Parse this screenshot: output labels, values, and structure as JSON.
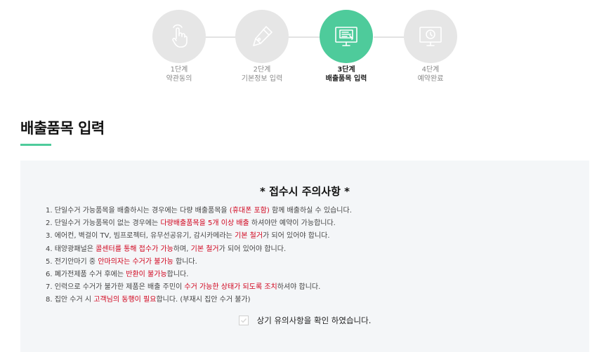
{
  "steps": [
    {
      "num": "1단계",
      "name": "약관동의",
      "icon": "hand-pointer-icon",
      "active": false
    },
    {
      "num": "2단계",
      "name": "기본정보 입력",
      "icon": "pen-icon",
      "active": false
    },
    {
      "num": "3단계",
      "name": "배출품목 입력",
      "icon": "monitor-form-icon",
      "active": true
    },
    {
      "num": "4단계",
      "name": "예약완료",
      "icon": "monitor-clock-icon",
      "active": false
    }
  ],
  "page": {
    "title": "배출품목 입력"
  },
  "notice": {
    "title": "*  접수시 주의사항  *",
    "items": [
      [
        {
          "t": "1. 단일수거 가능품목을 배출하시는 경우에는 다량 배출품목을 "
        },
        {
          "t": "(휴대폰 포함)",
          "c": "red"
        },
        {
          "t": " 함께 배출하실 수 있습니다."
        }
      ],
      [
        {
          "t": "2. 단일수거 가능품목이 없는 경우에는 "
        },
        {
          "t": "다량배출품목을 5개 이상 배출",
          "c": "red"
        },
        {
          "t": " 하셔야만 예약이 가능합니다."
        }
      ],
      [
        {
          "t": "3. 에어컨, 벽걸이 TV, 빔프로젝터, 유무선공유기, 감시카메라는 "
        },
        {
          "t": "기본 철거",
          "c": "red"
        },
        {
          "t": "가 되어 있어야 합니다."
        }
      ],
      [
        {
          "t": "4. 태양광패널은 "
        },
        {
          "t": "콜센터를 통해 접수가 가능",
          "c": "red"
        },
        {
          "t": "하며, "
        },
        {
          "t": "기본 철거",
          "c": "red"
        },
        {
          "t": "가 되어 있어야 합니다."
        }
      ],
      [
        {
          "t": "5. 전기안마기 중 "
        },
        {
          "t": "안마의자는 수거가 불가능",
          "c": "red"
        },
        {
          "t": " 합니다."
        }
      ],
      [
        {
          "t": "6. 폐가전제품 수거 후에는 "
        },
        {
          "t": "반환이 불가능",
          "c": "red"
        },
        {
          "t": "합니다."
        }
      ],
      [
        {
          "t": "7. 인력으로 수거가 불가한 제품은 배출 주민이 "
        },
        {
          "t": "수거 가능한 상태가 되도록 조치",
          "c": "red"
        },
        {
          "t": "하셔야 합니다."
        }
      ],
      [
        {
          "t": "8. 집안 수거 시 "
        },
        {
          "t": "고객님의 동행이 필요",
          "c": "red"
        },
        {
          "t": "합니다. (부재시 집안 수거 불가)"
        }
      ]
    ],
    "confirm_label": "상기 유의사항을 확인 하였습니다.",
    "confirm_checked": false
  },
  "colors": {
    "accent": "#4ecb9b",
    "inactive_circle": "#e6e6e6",
    "notice_bg": "#f4f6f8",
    "emphasis": "#d0021b"
  }
}
